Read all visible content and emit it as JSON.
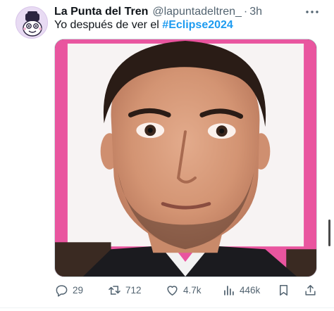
{
  "tweet": {
    "author": {
      "display_name": "La Punta del Tren",
      "handle": "@lapuntadeltren_",
      "separator": "·",
      "time": "3h",
      "avatar_icon": "cartoon-train-character-avatar"
    },
    "text": {
      "prefix": "Yo después de ver el ",
      "hashtag": "#Eclipse2024"
    },
    "media": {
      "description_icon": "photo-of-man-wide-eyed-pink-frame"
    },
    "actions": {
      "replies": "29",
      "retweets": "712",
      "likes": "4.7k",
      "views": "446k"
    }
  },
  "colors": {
    "hashtag": "#1d9bf0",
    "secondary_text": "#536471",
    "primary_text": "#0f1419",
    "photo_frame_pink": "#e9559f"
  }
}
